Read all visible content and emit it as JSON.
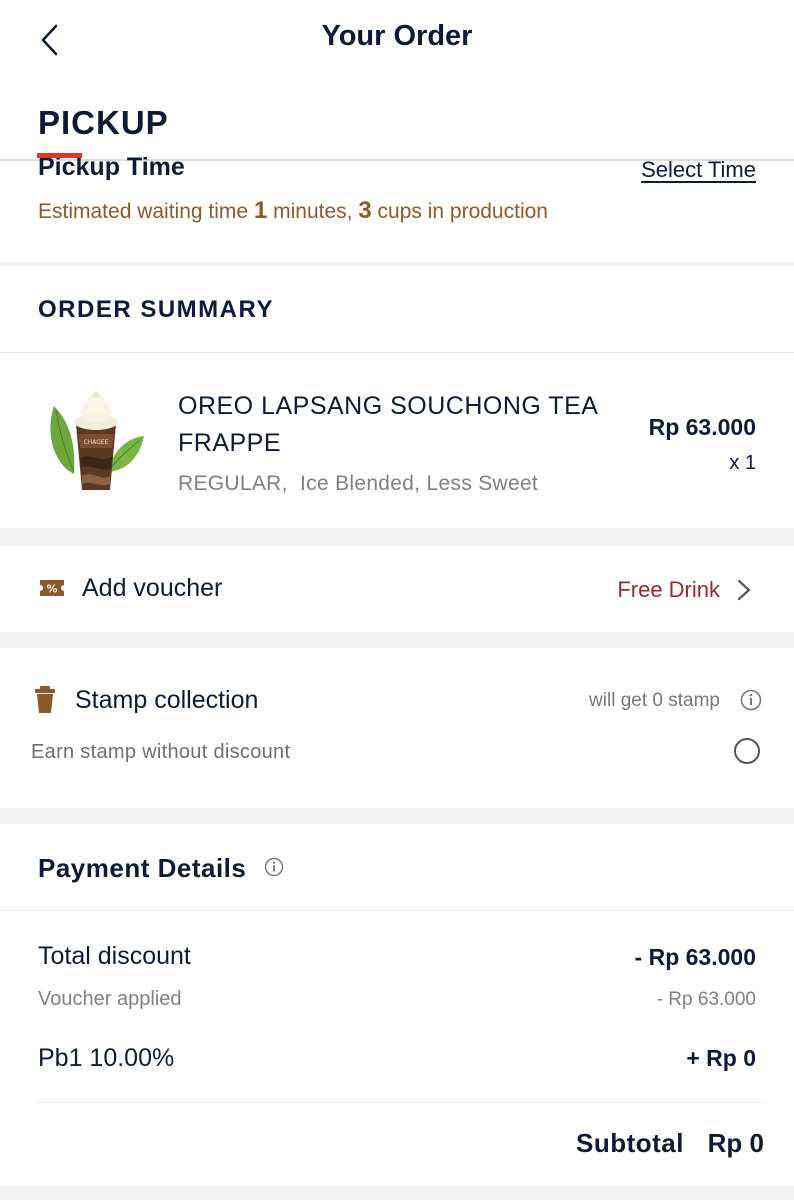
{
  "header": {
    "title": "Your Order",
    "tab": "PICKUP"
  },
  "pickup": {
    "label": "Pickup Time",
    "select_time": "Select Time",
    "estimate": {
      "prefix": "Estimated waiting time ",
      "minutes": "1",
      "middle": " minutes, ",
      "cups": "3",
      "suffix": " cups in production"
    }
  },
  "summary": {
    "heading": "ORDER SUMMARY",
    "item": {
      "name": "OREO LAPSANG SOUCHONG TEA FRAPPE",
      "options": "REGULAR,  Ice Blended, Less Sweet",
      "price": "Rp 63.000",
      "qty": "x 1",
      "cup_text": "CHAGEE"
    }
  },
  "voucher": {
    "label": "Add voucher",
    "value": "Free Drink"
  },
  "stamp": {
    "label": "Stamp collection",
    "value": "will get 0 stamp",
    "earn_label": "Earn stamp without discount"
  },
  "payment": {
    "heading": "Payment Details",
    "rows": [
      {
        "label": "Total discount",
        "value": "- Rp 63.000"
      },
      {
        "label": "Voucher applied",
        "value": "- Rp 63.000"
      },
      {
        "label": "Pb1 10.00%",
        "value": "+ Rp 0"
      }
    ],
    "subtotal_label": "Subtotal",
    "subtotal_value": "Rp 0"
  },
  "colors": {
    "accent_red": "#e2332c",
    "brand_brown": "#8a5a2b",
    "voucher_red": "#9b2a2a",
    "navy": "#0f1b36"
  }
}
